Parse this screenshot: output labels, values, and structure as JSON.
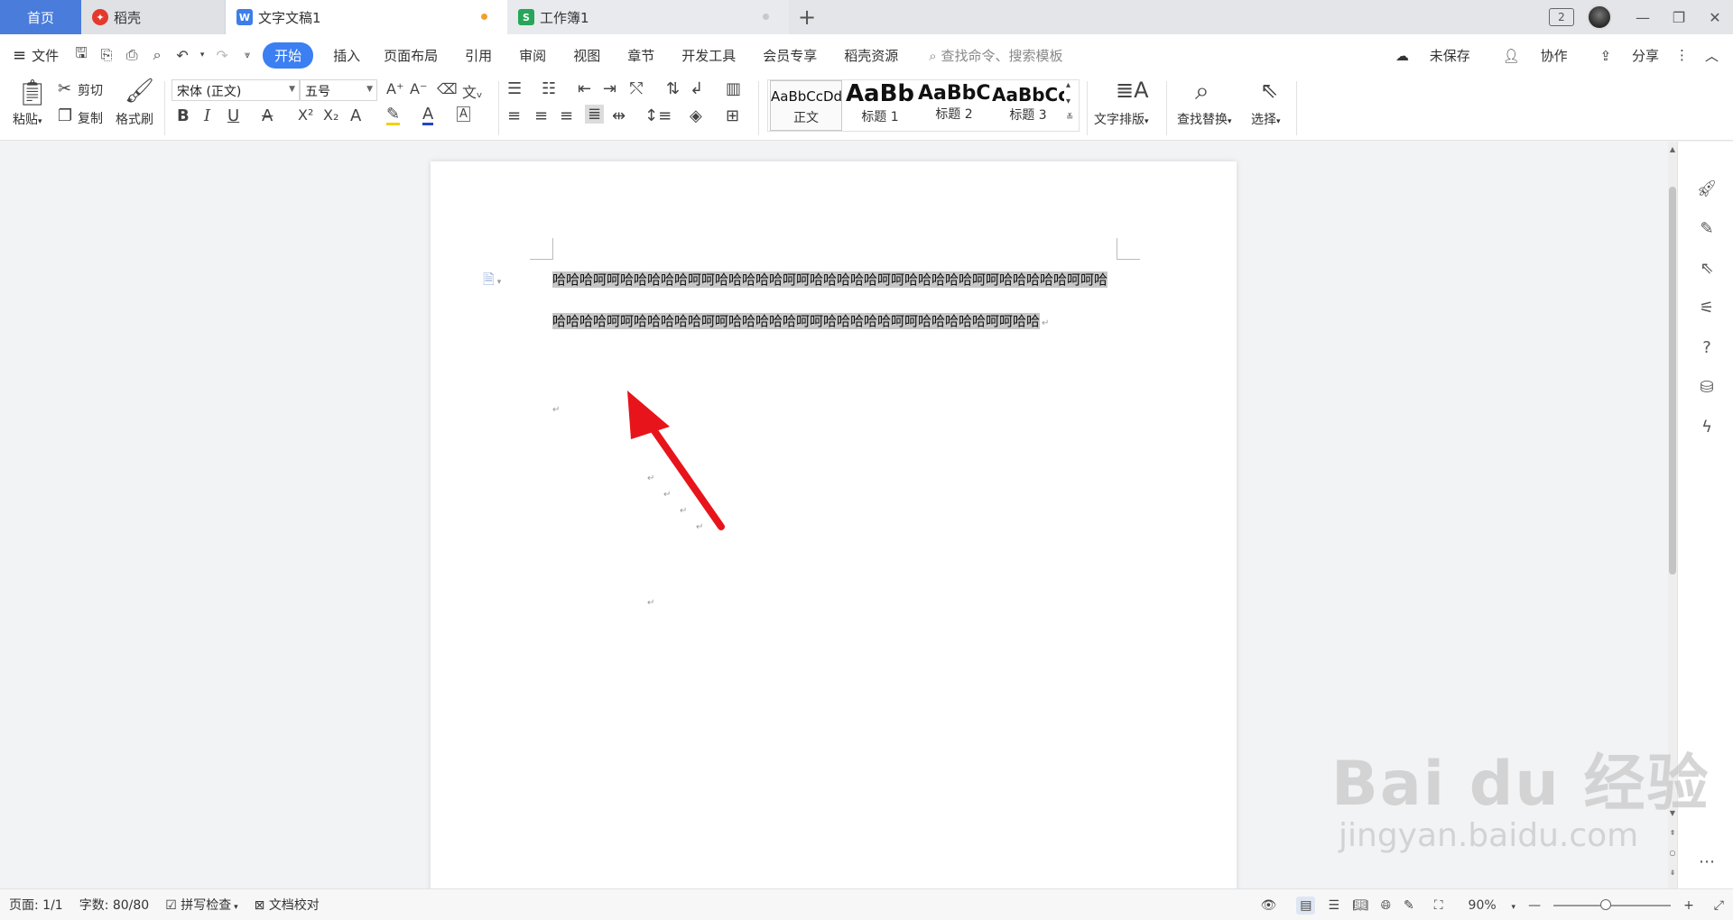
{
  "tabs": {
    "home": "首页",
    "docer": "稻壳",
    "document": "文字文稿1",
    "workbook": "工作簿1",
    "add": "+",
    "window_badge": "2"
  },
  "menu": {
    "file": "文件",
    "items": [
      "开始",
      "插入",
      "页面布局",
      "引用",
      "审阅",
      "视图",
      "章节",
      "开发工具",
      "会员专享",
      "稻壳资源"
    ],
    "search_placeholder": "查找命令、搜索模板",
    "unsaved": "未保存",
    "collab": "协作",
    "share": "分享"
  },
  "ribbon": {
    "paste": "粘贴",
    "cut": "剪切",
    "copy": "复制",
    "format_painter": "格式刷",
    "font_name": "宋体 (正文)",
    "font_size": "五号",
    "styles": [
      {
        "sample": "AaBbCcDd",
        "caption": "正文"
      },
      {
        "sample": "AaBb",
        "caption": "标题 1"
      },
      {
        "sample": "AaBbC",
        "caption": "标题 2"
      },
      {
        "sample": "AaBbCc",
        "caption": "标题 3"
      }
    ],
    "text_layout": "文字排版",
    "find_replace": "查找替换",
    "select": "选择"
  },
  "document": {
    "selected_text": "哈哈哈呵呵哈哈哈哈哈呵呵哈哈哈哈哈呵呵哈哈哈哈哈呵呵哈哈哈哈哈呵呵哈哈哈哈哈呵呵哈哈哈哈哈呵呵哈哈哈哈哈呵呵哈哈哈哈哈呵呵哈哈哈哈哈呵呵哈哈哈哈哈呵呵哈哈",
    "paragraph_mark": "↵"
  },
  "status": {
    "page": "页面: 1/1",
    "word_count": "字数: 80/80",
    "spell_check": "拼写检查",
    "doc_proof": "文档校对",
    "zoom": "90%",
    "zoom_level_percent": 90
  },
  "watermark": {
    "brand": "Bai du 经验",
    "url": "jingyan.baidu.com"
  },
  "colors": {
    "accent": "#3b7ff3",
    "home_tab": "#4a7cdb",
    "selection": "#c6c6c6",
    "arrow": "#e8141b",
    "unsaved_dot": "#f0a030"
  }
}
